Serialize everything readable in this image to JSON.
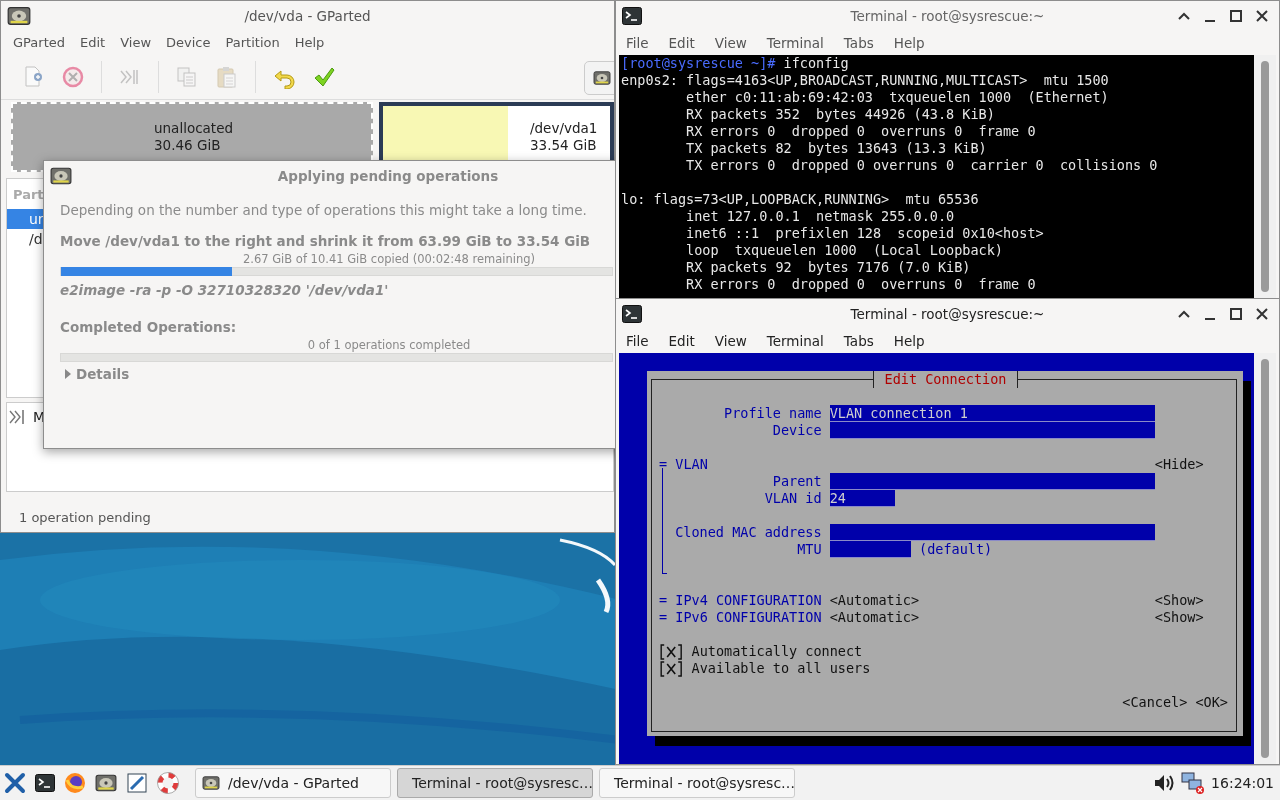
{
  "gparted": {
    "title": "/dev/vda - GParted",
    "menu": [
      "GParted",
      "Edit",
      "View",
      "Device",
      "Partition",
      "Help"
    ],
    "toolbar": [
      {
        "kind": "new",
        "disabled": true
      },
      {
        "kind": "delete",
        "disabled": true
      },
      {
        "kind": "sep"
      },
      {
        "kind": "resize",
        "disabled": true
      },
      {
        "kind": "sep"
      },
      {
        "kind": "copy",
        "disabled": true
      },
      {
        "kind": "paste",
        "disabled": true
      },
      {
        "kind": "sep"
      },
      {
        "kind": "undo",
        "disabled": false
      },
      {
        "kind": "apply",
        "disabled": false
      }
    ],
    "disk": [
      {
        "kind": "unallocated",
        "name": "unallocated",
        "size": "30.46 GiB",
        "selected": true
      },
      {
        "kind": "partition",
        "name": "/dev/vda1",
        "size": "33.54 GiB",
        "selected": false,
        "level": 0.55
      }
    ],
    "partitions": {
      "header": "Part",
      "rows": [
        {
          "name": "ur",
          "selected": true
        },
        {
          "name": "/d",
          "selected": false
        }
      ]
    },
    "log": [
      {
        "kind": "move",
        "text": "M"
      }
    ],
    "status": "1 operation pending"
  },
  "dialog": {
    "title": "Applying pending operations",
    "intro": "Depending on the number and type of operations this might take a long time.",
    "operation": "Move /dev/vda1 to the right and shrink it from 63.99 GiB to 33.54 GiB",
    "progress": {
      "text": "2.67 GiB of 10.41 GiB copied (00:02:48 remaining)",
      "level": 0.31
    },
    "command": "e2image -ra -p -O 32710328320 '/dev/vda1'",
    "completed": {
      "label": "Completed Operations:",
      "text": "0 of 1 operations completed",
      "level": 0
    },
    "details": {
      "label": "Details",
      "expanded": false
    }
  },
  "terminal_1": {
    "title": "Terminal - root@sysrescue:~",
    "menu": [
      "File",
      "Edit",
      "View",
      "Terminal",
      "Tabs",
      "Help"
    ],
    "prompt": "[root@sysrescue ~]#",
    "command": "ifconfig",
    "blocks": [
      [
        {
          "text": "enp0s2: flags=4163<UP,BROADCAST,RUNNING,MULTICAST>  mtu 1500",
          "indented": false
        },
        {
          "text": "ether c0:11:ab:69:42:03  txqueuelen 1000  (Ethernet)",
          "indented": true
        },
        {
          "text": "RX packets 352  bytes 44926 (43.8 KiB)",
          "indented": true
        },
        {
          "text": "RX errors 0  dropped 0  overruns 0  frame 0",
          "indented": true
        },
        {
          "text": "TX packets 82  bytes 13643 (13.3 KiB)",
          "indented": true
        },
        {
          "text": "TX errors 0  dropped 0 overruns 0  carrier 0  collisions 0",
          "indented": true
        }
      ],
      [
        {
          "text": "lo: flags=73<UP,LOOPBACK,RUNNING>  mtu 65536",
          "indented": false
        },
        {
          "text": "inet 127.0.0.1  netmask 255.0.0.0",
          "indented": true
        },
        {
          "text": "inet6 ::1  prefixlen 128  scopeid 0x10<host>",
          "indented": true
        },
        {
          "text": "loop  txqueuelen 1000  (Local Loopback)",
          "indented": true
        },
        {
          "text": "RX packets 92  bytes 7176 (7.0 KiB)",
          "indented": true
        },
        {
          "text": "RX errors 0  dropped 0  overruns 0  frame 0",
          "indented": true
        }
      ]
    ]
  },
  "terminal_2": {
    "title": "Terminal - root@sysrescue:~",
    "menu": [
      "File",
      "Edit",
      "View",
      "Terminal",
      "Tabs",
      "Help"
    ],
    "tui": {
      "title": "Edit Connection",
      "fields": [
        {
          "label": "Profile name",
          "value": "VLAN connection 1",
          "kind": "wide"
        },
        {
          "label": "Device",
          "kind": "wide"
        }
      ],
      "vlan": {
        "marker": "=",
        "label": "VLAN",
        "toggle": "<Hide>",
        "expanded": true,
        "groups": [
          [
            {
              "label": "Parent",
              "kind": "wide"
            },
            {
              "label": "VLAN id",
              "value": "24",
              "kind": "short"
            }
          ],
          [
            {
              "label": "Cloned MAC address",
              "kind": "wide"
            },
            {
              "label": "MTU",
              "kind": "medium",
              "note": "(default)"
            }
          ]
        ]
      },
      "sections": [
        {
          "marker": "=",
          "label": "IPv4 CONFIGURATION",
          "value": "<Automatic>",
          "toggle": "<Show>"
        },
        {
          "marker": "=",
          "label": "IPv6 CONFIGURATION",
          "value": "<Automatic>",
          "toggle": "<Show>"
        }
      ],
      "checks": [
        {
          "label": "Automatically connect",
          "checked": true
        },
        {
          "label": "Available to all users",
          "checked": true
        }
      ],
      "buttons": [
        "<Cancel>",
        "<OK>"
      ]
    }
  },
  "taskbar": {
    "windows": [
      {
        "kind": "gparted",
        "label": "/dev/vda - GParted",
        "selected": false
      },
      {
        "kind": "terminal",
        "label": "Terminal - root@sysresc…",
        "selected": true
      },
      {
        "kind": "terminal",
        "label": "Terminal - root@sysresc…",
        "selected": false
      }
    ],
    "clock": "16:24:01"
  }
}
